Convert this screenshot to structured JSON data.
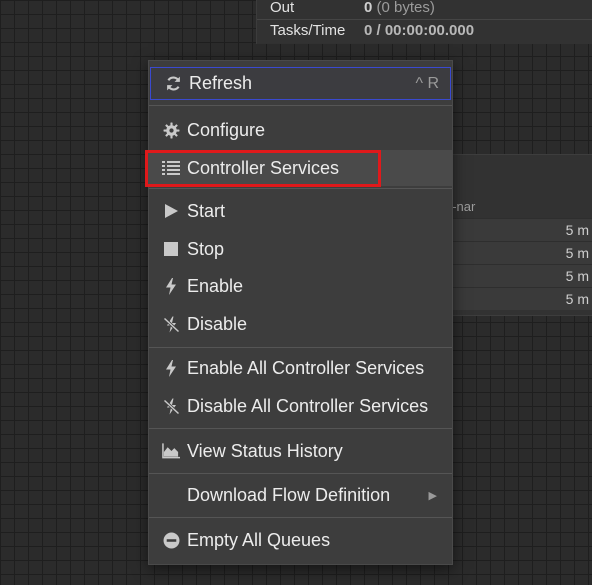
{
  "stats": {
    "out_label": "Out",
    "out_value": "0",
    "out_detail": "(0 bytes)",
    "tasks_label": "Tasks/Time",
    "tasks_value": "0 / 00:00:00.000"
  },
  "processor": {
    "nar_label": "d-nar",
    "row_values": [
      "5 m",
      "5 m",
      "5 m",
      "5 m"
    ]
  },
  "menu": {
    "refresh": {
      "label": "Refresh",
      "shortcut": "^ R"
    },
    "configure": "Configure",
    "controller_services": "Controller Services",
    "start": "Start",
    "stop": "Stop",
    "enable": "Enable",
    "disable": "Disable",
    "enable_all": "Enable All Controller Services",
    "disable_all": "Disable All Controller Services",
    "status_history": "View Status History",
    "download_flow": "Download Flow Definition",
    "empty_queues": "Empty All Queues"
  },
  "colors": {
    "highlight": "#e0191b",
    "focus_outline": "#3a4ad0",
    "menu_bg": "#3d3d3d"
  }
}
